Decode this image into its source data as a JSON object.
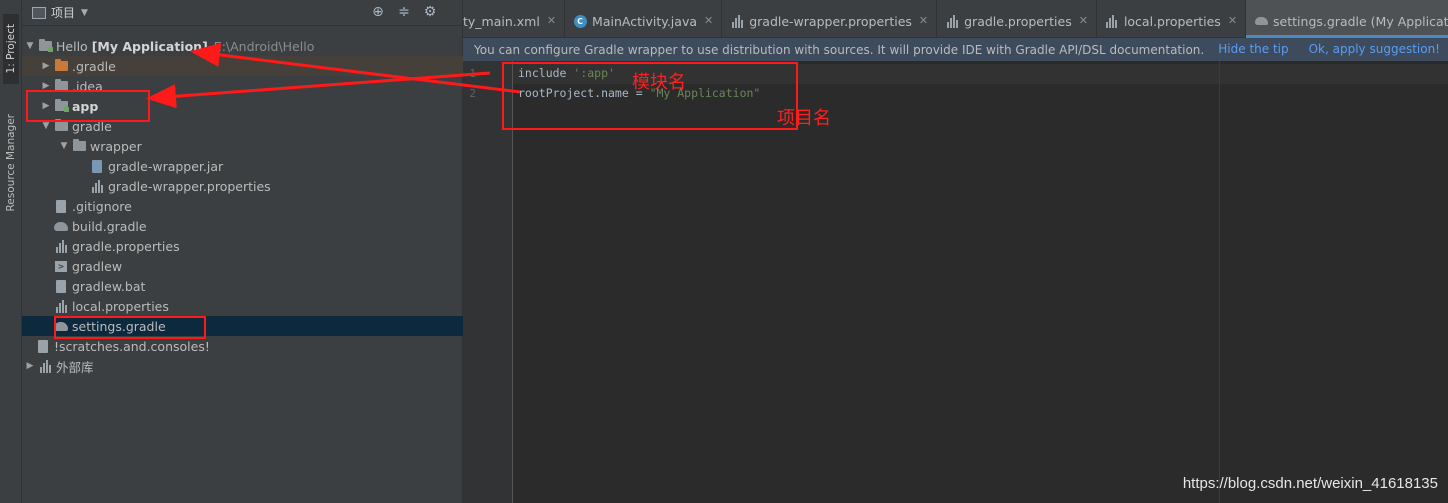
{
  "tool_window": {
    "project_tab": "1: Project",
    "resource_tab": "Resource Manager",
    "header_label": "项目"
  },
  "tree": {
    "root_name": "Hello",
    "root_project": "[My Application]",
    "root_path": "E:\\Android\\Hello",
    "items": [
      {
        "label": ".gradle"
      },
      {
        "label": ".idea"
      },
      {
        "label": "app"
      },
      {
        "label": "gradle"
      },
      {
        "label": "wrapper"
      },
      {
        "label": "gradle-wrapper.jar"
      },
      {
        "label": "gradle-wrapper.properties"
      },
      {
        "label": ".gitignore"
      },
      {
        "label": "build.gradle"
      },
      {
        "label": "gradle.properties"
      },
      {
        "label": "gradlew"
      },
      {
        "label": "gradlew.bat"
      },
      {
        "label": "local.properties"
      },
      {
        "label": "settings.gradle"
      },
      {
        "label": "!scratches.and.consoles!"
      },
      {
        "label": "外部库"
      }
    ]
  },
  "tabs": [
    {
      "label": "ty_main.xml"
    },
    {
      "label": "MainActivity.java"
    },
    {
      "label": "gradle-wrapper.properties"
    },
    {
      "label": "gradle.properties"
    },
    {
      "label": "local.properties"
    },
    {
      "label": "settings.gradle (My Application)"
    }
  ],
  "banner": {
    "message": "You can configure Gradle wrapper to use distribution with sources. It will provide IDE with Gradle API/DSL documentation.",
    "hide_tip": "Hide the tip",
    "apply": "Ok, apply suggestion!"
  },
  "editor": {
    "line_numbers": [
      "1",
      "2"
    ],
    "line1_code": "include ",
    "line1_string": "':app'",
    "line2_code": "rootProject.name = ",
    "line2_string": "\"My Application\""
  },
  "annotations": {
    "module_name": "模块名",
    "project_name": "项目名",
    "color": "#ff1a1a"
  },
  "watermark": "https://blog.csdn.net/weixin_41618135"
}
